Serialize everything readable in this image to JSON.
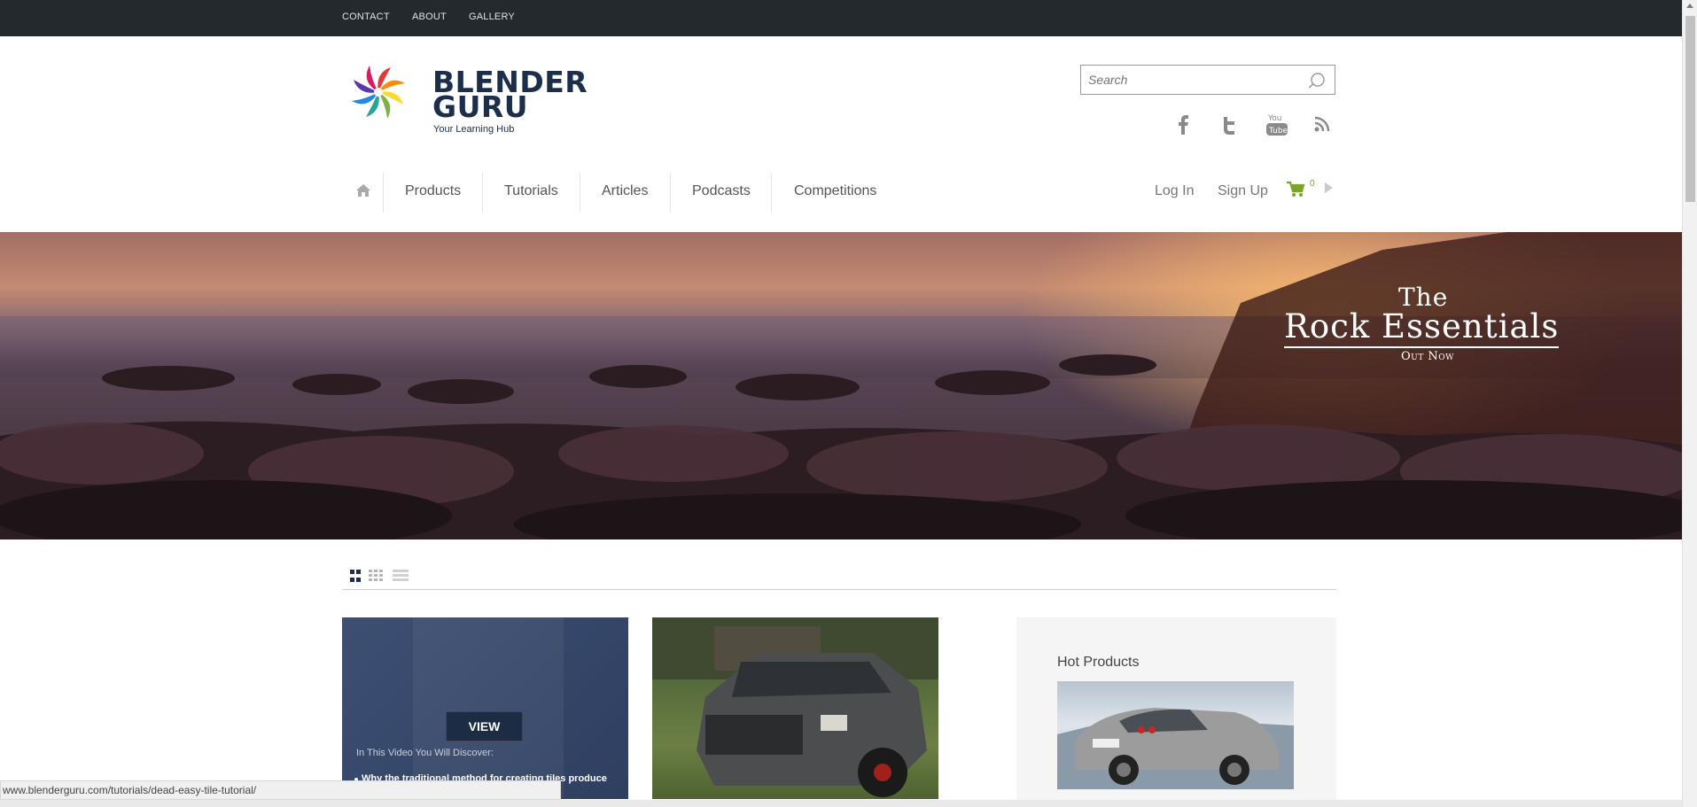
{
  "topbar": {
    "links": [
      "CONTACT",
      "ABOUT",
      "GALLERY"
    ]
  },
  "logo": {
    "line1": "BLENDER",
    "line2": "GURU",
    "tagline": "Your Learning Hub"
  },
  "search": {
    "placeholder": "Search"
  },
  "social": {
    "icons": [
      "facebook-icon",
      "twitter-icon",
      "youtube-icon",
      "rss-icon"
    ]
  },
  "nav": {
    "items": [
      "Products",
      "Tutorials",
      "Articles",
      "Podcasts",
      "Competitions"
    ],
    "login": "Log In",
    "signup": "Sign Up",
    "cart_count": "0"
  },
  "banner": {
    "line1": "The",
    "line2": "Rock Essentials",
    "line3": "Out Now"
  },
  "cards": {
    "card1": {
      "button": "VIEW",
      "heading": "In This Video You Will Discover:",
      "bullet": "Why the traditional method for creating tiles produce"
    }
  },
  "sidebar": {
    "title": "Hot Products"
  },
  "status": {
    "url": "www.blenderguru.com/tutorials/dead-easy-tile-tutorial/"
  },
  "colors": {
    "topbar": "#24292d",
    "brand": "#1b2e4a",
    "cart": "#7aa52d"
  }
}
